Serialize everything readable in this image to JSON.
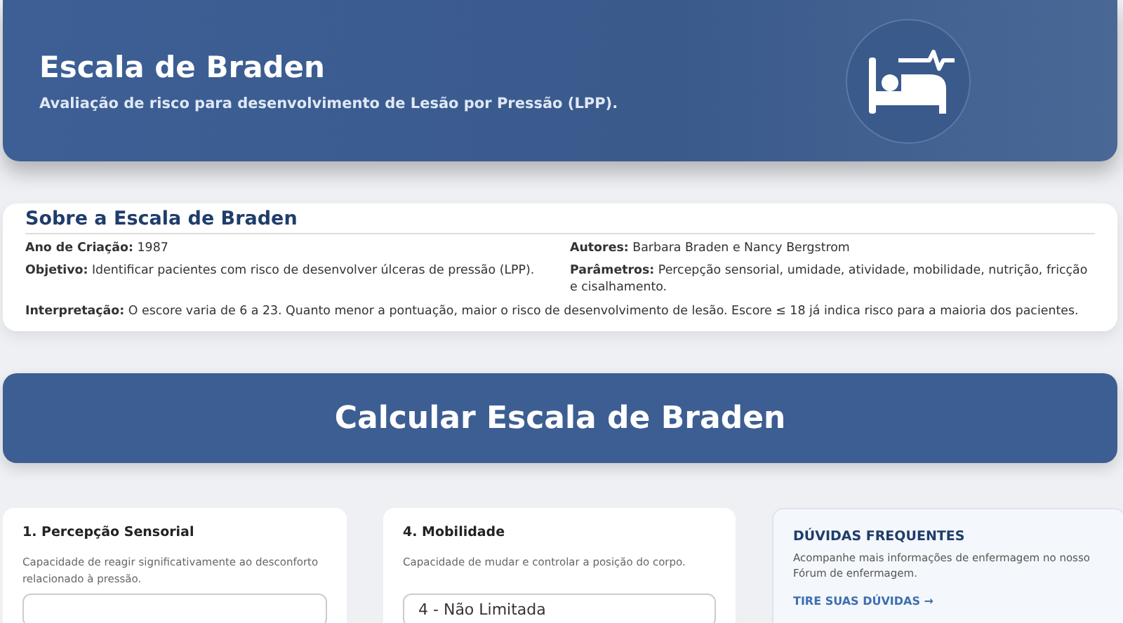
{
  "header": {
    "title": "Escala de Braden",
    "subtitle": "Avaliação de risco para desenvolvimento de Lesão por Pressão (LPP)."
  },
  "about": {
    "title": "Sobre a Escala de Braden",
    "items": [
      {
        "label": "Ano de Criação:",
        "text": "1987"
      },
      {
        "label": "Autores:",
        "text": "Barbara Braden e Nancy Bergstrom"
      },
      {
        "label": "Objetivo:",
        "text": "Identificar pacientes com risco de desenvolver úlceras de pressão (LPP)."
      },
      {
        "label": "Parâmetros:",
        "text": "Percepção sensorial, umidade, atividade, mobilidade, nutrição, fricção e cisalhamento."
      }
    ],
    "interpretation": {
      "label": "Interpretação:",
      "text": "O escore varia de 6 a 23. Quanto menor a pontuação, maior o risco de desenvolvimento de lesão. Escore ≤ 18 já indica risco para a maioria dos pacientes."
    }
  },
  "calc_banner": "Calcular Escala de Braden",
  "criteria": [
    {
      "title": "1. Percepção Sensorial",
      "description": "Capacidade de reagir significativamente ao desconforto relacionado à pressão."
    },
    {
      "title": "4. Mobilidade",
      "description": "Capacidade de mudar e controlar a posição do corpo.",
      "value": "4 - Não Limitada"
    }
  ],
  "faq": {
    "title": "DÚVIDAS FREQUENTES",
    "text": "Acompanhe mais informações de enfermagem no nosso Fórum de enfermagem.",
    "link": "TIRE SUAS DÚVIDAS →"
  }
}
